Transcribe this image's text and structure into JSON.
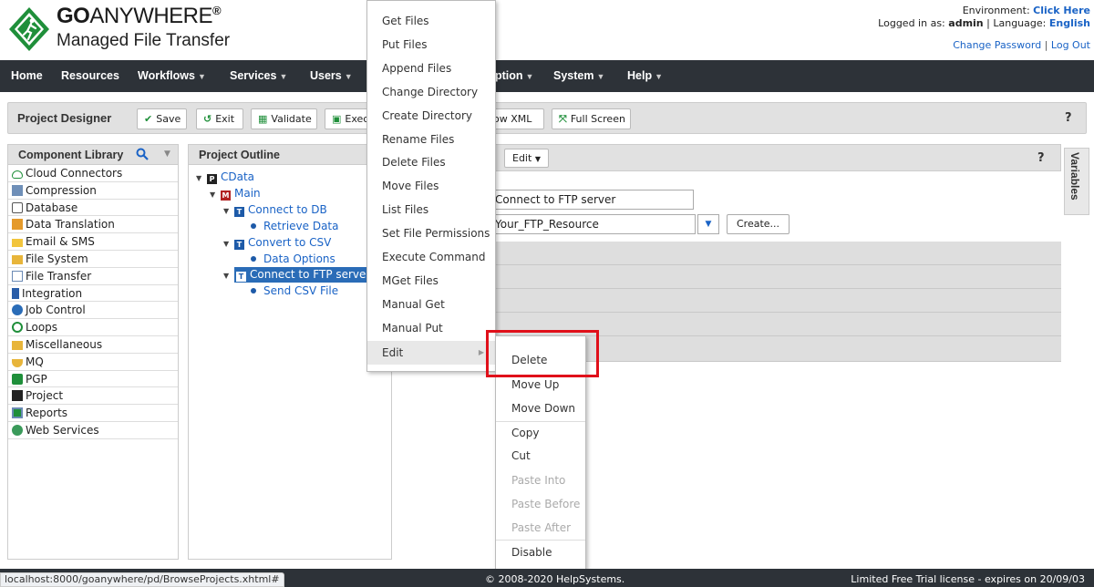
{
  "header": {
    "brand_bold": "GO",
    "brand_thin": "ANYWHERE",
    "brand_reg": "®",
    "brand_sub": "Managed File Transfer",
    "env_label": "Environment:",
    "env_link": "Click Here",
    "logged_label": "Logged in as:",
    "user": "admin",
    "lang_label": "Language:",
    "language": "English",
    "change_password": "Change Password",
    "separator": "|",
    "logout": "Log Out"
  },
  "nav": {
    "items": [
      "Home",
      "Resources",
      "Workflows",
      "Services",
      "Users",
      "Encryption",
      "System",
      "Help"
    ],
    "truncated_encryption": "ption"
  },
  "toolbar": {
    "title": "Project Designer",
    "save": "Save",
    "exit": "Exit",
    "validate": "Validate",
    "execute": "Exec",
    "show_xml": "ow XML",
    "full_screen": "Full Screen",
    "help": "?"
  },
  "library": {
    "title": "Component Library",
    "items": [
      "Cloud Connectors",
      "Compression",
      "Database",
      "Data Translation",
      "Email & SMS",
      "File System",
      "File Transfer",
      "Integration",
      "Job Control",
      "Loops",
      "Miscellaneous",
      "MQ",
      "PGP",
      "Project",
      "Reports",
      "Web Services"
    ]
  },
  "outline": {
    "title": "Project Outline",
    "project": "CData",
    "main": "Main",
    "connect_db": "Connect to DB",
    "retrieve": "Retrieve Data",
    "convert": "Convert to CSV",
    "data_options": "Data Options",
    "connect_ftp": "Connect to FTP server",
    "send_csv": "Send CSV File"
  },
  "panel": {
    "edit": "Edit",
    "help": "?",
    "label_value": "Connect to FTP server",
    "resource_value": "Your_FTP_Resource",
    "create": "Create..."
  },
  "variables_tab": "Variables",
  "context_menu": {
    "items": [
      "Get Files",
      "Put Files",
      "Append Files",
      "Change Directory",
      "Create Directory",
      "Rename Files",
      "Delete Files",
      "Move Files",
      "List Files",
      "Set File Permissions",
      "Execute Command",
      "MGet Files",
      "Manual Get",
      "Manual Put",
      "Edit"
    ]
  },
  "edit_submenu": {
    "delete": "Delete",
    "move_up": "Move Up",
    "move_down": "Move Down",
    "copy": "Copy",
    "cut": "Cut",
    "paste_into": "Paste Into",
    "paste_before": "Paste Before",
    "paste_after": "Paste After",
    "disable": "Disable"
  },
  "footer": {
    "status_url": "localhost:8000/goanywhere/pd/BrowseProjects.xhtml#",
    "copyright": "© 2008-2020 HelpSystems.",
    "license": "Limited Free Trial license - expires on 20/09/03"
  },
  "colors": {
    "nav_bg": "#2d3238",
    "accent_blue": "#1a63c6",
    "selection_blue": "#2a6cb7",
    "highlight_red": "#e0101a",
    "logo_green": "#1f8f3a"
  }
}
